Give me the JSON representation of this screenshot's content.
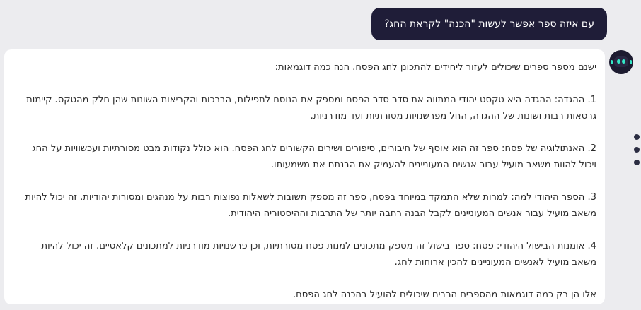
{
  "user_message": "עם איזה ספר אפשר לעשות \"הכנה\" לקראת החג?",
  "assistant": {
    "intro": "ישנם מספר ספרים שיכולים לעזור ליחידים להתכונן לחג הפסח. הנה כמה דוגמאות:",
    "items": [
      "1. ההגדה: ההגדה היא טקסט יהודי המתווה את סדר סדר הפסח ומספק את הנוסח לתפילות, הברכות והקריאות השונות שהן חלק מהטקס. קיימות גרסאות רבות ושונות של ההגדה, החל מפרשנויות מסורתיות ועד מודרניות.",
      "2. האנתולוגיה של פסח: ספר זה הוא אוסף של חיבורים, סיפורים ושירים הקשורים לחג הפסח. הוא כולל נקודות מבט מסורתיות ועכשוויות על החג ויכול להוות משאב מועיל עבור אנשים המעוניינים להעמיק את הבנתם את משמעותו.",
      "3. הספר היהודי למה: למרות שלא התמקד במיוחד בפסח, ספר זה מספק תשובות לשאלות נפוצות רבות על מנהגים ומסורות יהודיות. זה יכול להיות משאב מועיל עבור אנשים המעוניינים לקבל הבנה רחבה יותר של התרבות וההיסטוריה היהודית.",
      "4. אומנות הבישול היהודי: פסח: ספר בישול זה מספק מתכונים למנות פסח מסורתיות, וכן פרשנויות מודרניות למתכונים קלאסיים. זה יכול להיות משאב מועיל לאנשים המעוניינים להכין ארוחות לחג."
    ],
    "outro": "אלו הן רק כמה דוגמאות מהספרים הרבים שיכולים להועיל בהכנה לחג הפסח."
  },
  "icons": {
    "avatar": "robot-icon",
    "menu": "more-vertical-icon"
  },
  "colors": {
    "background": "#ececef",
    "user_bubble": "#1f1d38",
    "bot_bubble": "#ffffff",
    "avatar_accent": "#34e7c6"
  }
}
